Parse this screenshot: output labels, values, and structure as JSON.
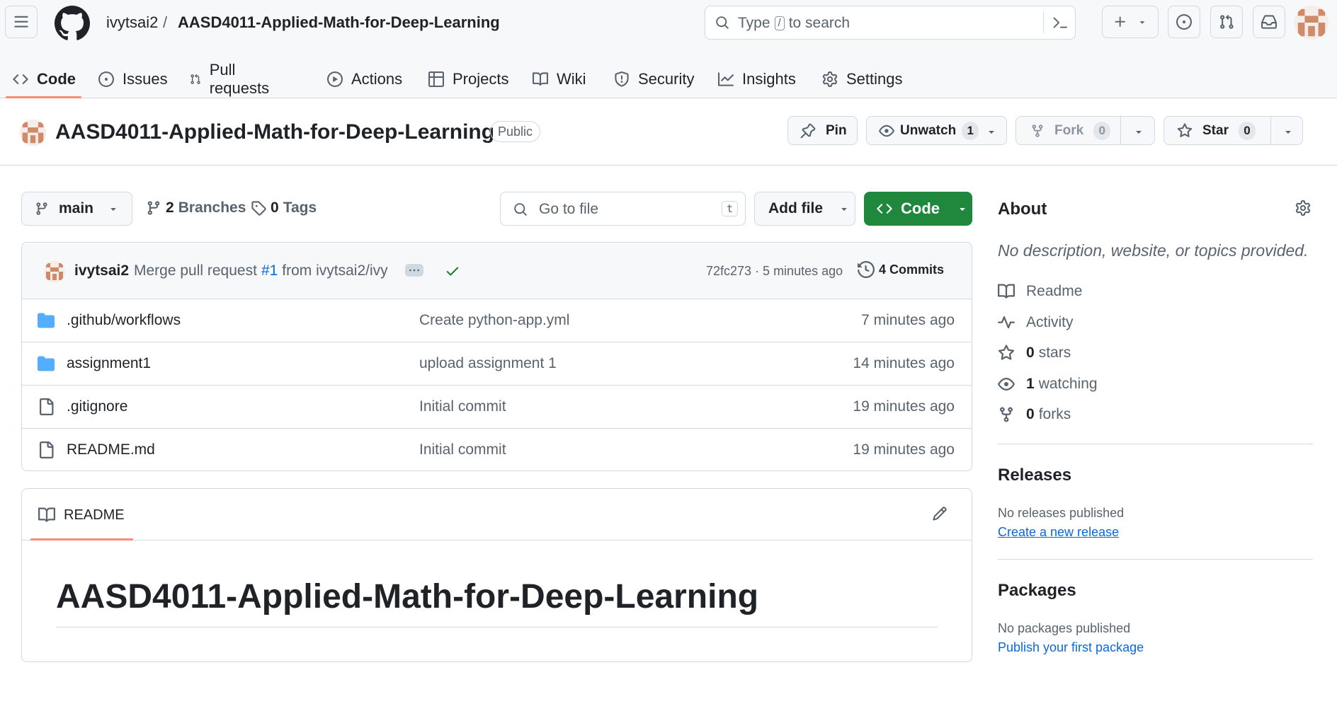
{
  "header": {
    "owner": "ivytsai2",
    "separator": "/",
    "repo": "AASD4011-Applied-Math-for-Deep-Learning",
    "search_prefix": "Type",
    "search_key": "/",
    "search_suffix": "to search"
  },
  "tabs": [
    {
      "label": "Code",
      "icon": "code-icon",
      "selected": true
    },
    {
      "label": "Issues",
      "icon": "issue-icon"
    },
    {
      "label": "Pull requests",
      "icon": "pull-request-icon"
    },
    {
      "label": "Actions",
      "icon": "play-icon"
    },
    {
      "label": "Projects",
      "icon": "table-icon"
    },
    {
      "label": "Wiki",
      "icon": "book-icon"
    },
    {
      "label": "Security",
      "icon": "shield-icon"
    },
    {
      "label": "Insights",
      "icon": "graph-icon"
    },
    {
      "label": "Settings",
      "icon": "gear-icon"
    }
  ],
  "repo": {
    "title": "AASD4011-Applied-Math-for-Deep-Learning",
    "visibility": "Public",
    "pin_label": "Pin",
    "watch_label": "Unwatch",
    "watch_count": "1",
    "fork_label": "Fork",
    "fork_count": "0",
    "star_label": "Star",
    "star_count": "0"
  },
  "branch_bar": {
    "branch": "main",
    "branches_count": "2",
    "branches_label": "Branches",
    "tags_count": "0",
    "tags_label": "Tags",
    "go_to_file_placeholder": "Go to file",
    "go_to_file_key": "t",
    "add_file_label": "Add file",
    "code_label": "Code"
  },
  "latest_commit": {
    "author": "ivytsai2",
    "message_prefix": "Merge pull request",
    "pr_ref": "#1",
    "message_suffix": "from ivytsai2/ivy",
    "hash_time": "72fc273 · 5 minutes ago",
    "commits_label": "4 Commits"
  },
  "files": [
    {
      "name": ".github/workflows",
      "type": "folder",
      "message": "Create python-app.yml",
      "date": "7 minutes ago"
    },
    {
      "name": "assignment1",
      "type": "folder",
      "message": "upload assignment 1",
      "date": "14 minutes ago"
    },
    {
      "name": ".gitignore",
      "type": "file",
      "message": "Initial commit",
      "date": "19 minutes ago"
    },
    {
      "name": "README.md",
      "type": "file",
      "message": "Initial commit",
      "date": "19 minutes ago"
    }
  ],
  "readme": {
    "tab_label": "README",
    "heading": "AASD4011-Applied-Math-for-Deep-Learning"
  },
  "sidebar": {
    "about_title": "About",
    "about_desc": "No description, website, or topics provided.",
    "readme_label": "Readme",
    "activity_label": "Activity",
    "stars_count": "0",
    "stars_label": "stars",
    "watching_count": "1",
    "watching_label": "watching",
    "forks_count": "0",
    "forks_label": "forks",
    "releases_title": "Releases",
    "releases_text": "No releases published",
    "releases_link": "Create a new release",
    "packages_title": "Packages",
    "packages_text": "No packages published",
    "packages_link": "Publish your first package"
  },
  "colors": {
    "accent_underline": "#fd8c73",
    "primary_green": "#1f883d",
    "link_blue": "#0969da",
    "folder_blue": "#54aeff",
    "check_green": "#1a7f37"
  }
}
